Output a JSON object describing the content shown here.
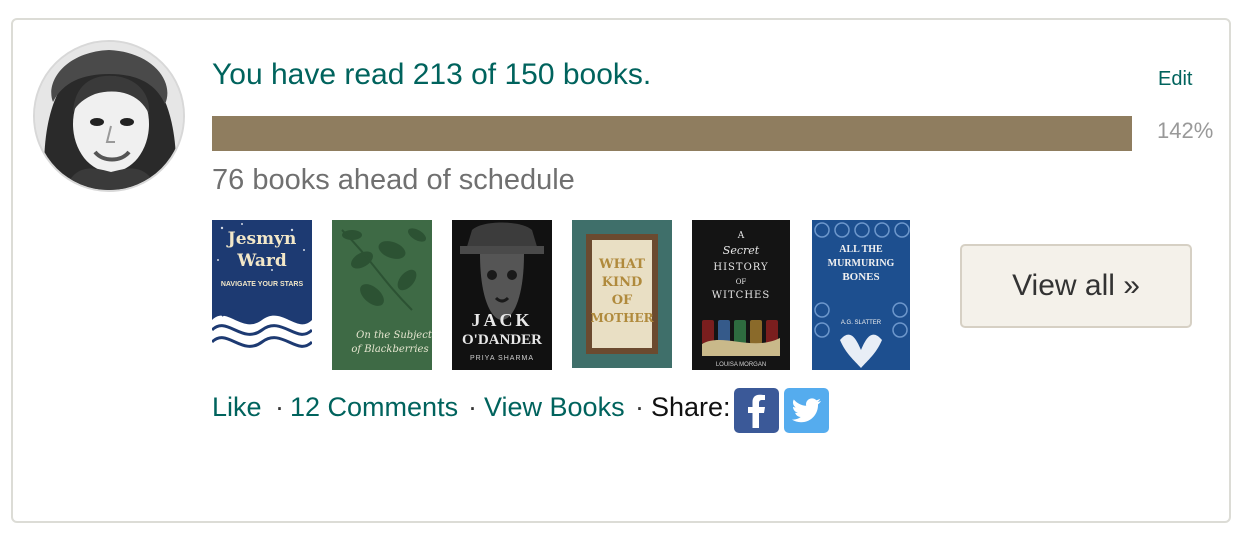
{
  "reading_challenge": {
    "title": "You have read 213 of 150 books.",
    "edit_label": "Edit",
    "progress_percent_label": "142%",
    "progress_fraction": 1.0,
    "schedule_text": "76 books ahead of schedule",
    "progress_color": "#8f7d5f"
  },
  "covers": [
    {
      "name": "navigate-your-stars",
      "author": "Jesmyn Ward",
      "line1": "Jesmyn",
      "line2": "Ward",
      "subtitle": "NAVIGATE YOUR STARS"
    },
    {
      "name": "on-the-subject-of-blackberries",
      "line1": "On the Subject",
      "line2": "of Blackberries"
    },
    {
      "name": "jack-odander",
      "line1": "JACK",
      "line2": "O'DANDER",
      "author": "PRIYA SHARMA"
    },
    {
      "name": "what-kind-of-mother",
      "line1": "WHAT",
      "line2": "KIND",
      "line3": "OF",
      "line4": "MOTHER"
    },
    {
      "name": "a-secret-history-of-witches",
      "line1": "A",
      "line2": "Secret",
      "line3": "HISTORY",
      "line4": "OF",
      "line5": "WITCHES",
      "author": "LOUISA MORGAN"
    },
    {
      "name": "all-the-murmuring-bones",
      "line1": "ALL THE",
      "line2": "MURMURING",
      "line3": "BONES",
      "author": "A.G. SLATTER"
    }
  ],
  "view_all_label": "View all »",
  "actions": {
    "like": "Like",
    "comments": "12 Comments",
    "view_books": "View Books",
    "share": "Share:",
    "separator": "·"
  },
  "share_icons": [
    "facebook-icon",
    "twitter-icon"
  ],
  "colors": {
    "link": "#00635d",
    "facebook": "#3b5998",
    "twitter": "#55acee"
  }
}
